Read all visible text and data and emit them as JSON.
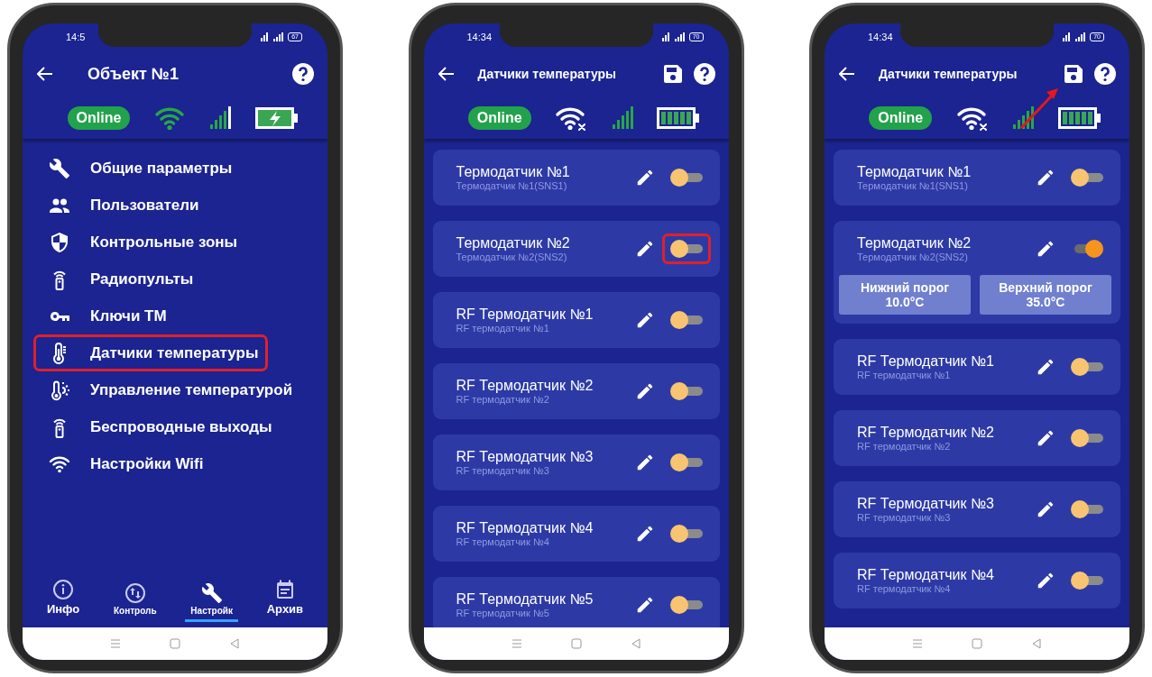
{
  "phones": [
    {
      "kind": "menu",
      "time": "14:5",
      "battery_text": "67",
      "title": "Объект №1",
      "online": "Online",
      "wifi_connected": true,
      "battery_charging": true,
      "menu": [
        {
          "kind": "wrench",
          "label": "Общие параметры",
          "highlighted": false
        },
        {
          "kind": "people",
          "label": "Пользователи",
          "highlighted": false
        },
        {
          "kind": "shield",
          "label": "Контрольные зоны",
          "highlighted": false
        },
        {
          "kind": "remote",
          "label": "Радиопульты",
          "highlighted": false
        },
        {
          "kind": "key",
          "label": "Ключи ТМ",
          "highlighted": false
        },
        {
          "kind": "thermometer",
          "label": "Датчики температуры",
          "highlighted": true
        },
        {
          "kind": "thermo-sun",
          "label": "Управление температурой",
          "highlighted": false
        },
        {
          "kind": "remote",
          "label": "Беспроводные выходы",
          "highlighted": false
        },
        {
          "kind": "wifi",
          "label": "Настройки Wifi",
          "highlighted": false
        }
      ],
      "nav": [
        {
          "kind": "info",
          "label": "Инфо",
          "selected": false
        },
        {
          "kind": "arrows",
          "label": "Контроль",
          "selected": false
        },
        {
          "kind": "wrench",
          "label": "Настройк",
          "selected": true
        },
        {
          "kind": "calendar",
          "label": "Архив",
          "selected": false
        }
      ]
    },
    {
      "kind": "sensors",
      "time": "14:34",
      "battery_text": "70",
      "title": "Датчики температуры",
      "save_button": true,
      "online": "Online",
      "wifi_connected": false,
      "battery_charging": false,
      "sensors": [
        {
          "name": "Термодатчик №1",
          "subtitle": "Термодатчик №1(SNS1)",
          "on": false,
          "highlighted": false
        },
        {
          "name": "Термодатчик №2",
          "subtitle": "Термодатчик №2(SNS2)",
          "on": false,
          "highlighted": true
        },
        {
          "name": "RF Термодатчик №1",
          "subtitle": "RF термодатчик №1",
          "on": false,
          "highlighted": false
        },
        {
          "name": "RF Термодатчик №2",
          "subtitle": "RF термодатчик №2",
          "on": false,
          "highlighted": false
        },
        {
          "name": "RF Термодатчик №3",
          "subtitle": "RF термодатчик №3",
          "on": false,
          "highlighted": false
        },
        {
          "name": "RF Термодатчик №4",
          "subtitle": "RF термодатчик №4",
          "on": false,
          "highlighted": false
        },
        {
          "name": "RF Термодатчик №5",
          "subtitle": "RF термодатчик №5",
          "on": false,
          "highlighted": false
        }
      ]
    },
    {
      "kind": "sensors",
      "time": "14:34",
      "battery_text": "70",
      "title": "Датчики температуры",
      "save_button": true,
      "save_arrow": true,
      "online": "Online",
      "wifi_connected": false,
      "battery_charging": false,
      "sensors": [
        {
          "name": "Термодатчик №1",
          "subtitle": "Термодатчик №1(SNS1)",
          "on": false,
          "highlighted": false
        },
        {
          "name": "Термодатчик №2",
          "subtitle": "Термодатчик №2(SNS2)",
          "on": true,
          "highlighted": false,
          "thresholds": [
            {
              "label": "Нижний порог",
              "value": "10.0°C"
            },
            {
              "label": "Верхний порог",
              "value": "35.0°C"
            }
          ]
        },
        {
          "name": "RF Термодатчик №1",
          "subtitle": "RF термодатчик №1",
          "on": false,
          "highlighted": false
        },
        {
          "name": "RF Термодатчик №2",
          "subtitle": "RF термодатчик №2",
          "on": false,
          "highlighted": false
        },
        {
          "name": "RF Термодатчик №3",
          "subtitle": "RF термодатчик №3",
          "on": false,
          "highlighted": false
        },
        {
          "name": "RF Термодатчик №4",
          "subtitle": "RF термодатчик №4",
          "on": false,
          "highlighted": false
        }
      ]
    }
  ]
}
